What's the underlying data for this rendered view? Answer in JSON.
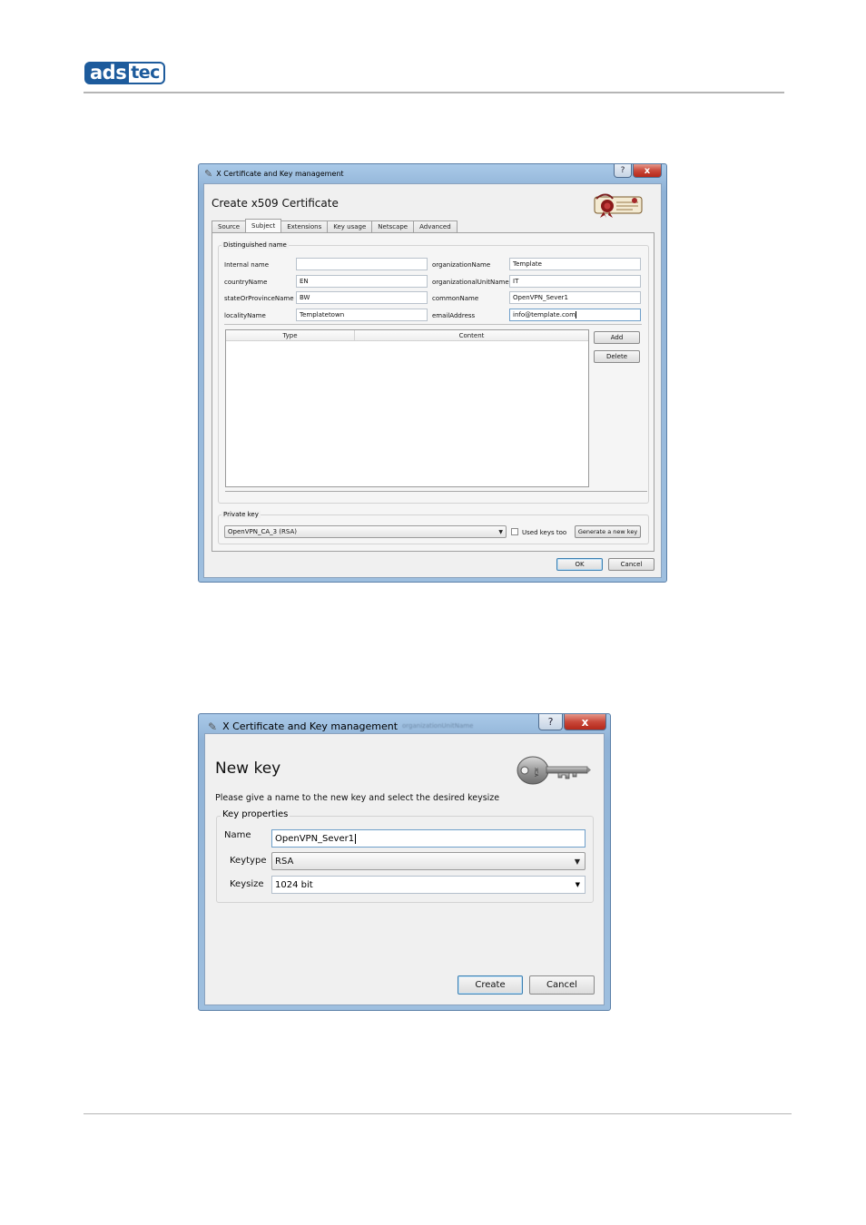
{
  "brand": {
    "part1": "ads",
    "part2": "tec"
  },
  "dialog1": {
    "window_title": "X Certificate and Key management",
    "help_glyph": "?",
    "close_glyph": "x",
    "heading": "Create x509 Certificate",
    "tabs": [
      {
        "label": "Source",
        "active": false
      },
      {
        "label": "Subject",
        "active": true
      },
      {
        "label": "Extensions",
        "active": false
      },
      {
        "label": "Key usage",
        "active": false
      },
      {
        "label": "Netscape",
        "active": false
      },
      {
        "label": "Advanced",
        "active": false
      }
    ],
    "dn_group_title": "Distinguished name",
    "fields": {
      "internal_name": {
        "label": "Internal name",
        "value": ""
      },
      "country_name": {
        "label": "countryName",
        "value": "EN"
      },
      "state_or_province_name": {
        "label": "stateOrProvinceName",
        "value": "BW"
      },
      "locality_name": {
        "label": "localityName",
        "value": "Templatetown"
      },
      "organization_name": {
        "label": "organizationName",
        "value": "Template"
      },
      "organizational_unit_name": {
        "label": "organizationalUnitName",
        "value": "IT"
      },
      "common_name": {
        "label": "commonName",
        "value": "OpenVPN_Sever1"
      },
      "email_address": {
        "label": "emailAddress",
        "value": "info@template.com"
      }
    },
    "table": {
      "col_type": "Type",
      "col_content": "Content"
    },
    "add_button": "Add",
    "delete_button": "Delete",
    "private_key": {
      "group_title": "Private key",
      "selected": "OpenVPN_CA_3 (RSA)",
      "used_keys_label": "Used keys too",
      "used_keys_checked": false,
      "generate_button": "Generate a new key"
    },
    "ok_button": "OK",
    "cancel_button": "Cancel"
  },
  "dialog2": {
    "window_title": "X Certificate and Key management",
    "ghost_text": "organizationUnitName",
    "help_glyph": "?",
    "close_glyph": "x",
    "heading": "New key",
    "instruction": "Please give a name to the new key and select the desired keysize",
    "group_title": "Key properties",
    "name_label": "Name",
    "name_value": "OpenVPN_Sever1",
    "keytype_label": "Keytype",
    "keytype_value": "RSA",
    "keysize_label": "Keysize",
    "keysize_value": "1024 bit",
    "create_button": "Create",
    "cancel_button": "Cancel"
  },
  "icons": {
    "window_icon": "certificate-pen-icon",
    "emblem": "certificate-seal-icon",
    "key": "key-icon"
  }
}
